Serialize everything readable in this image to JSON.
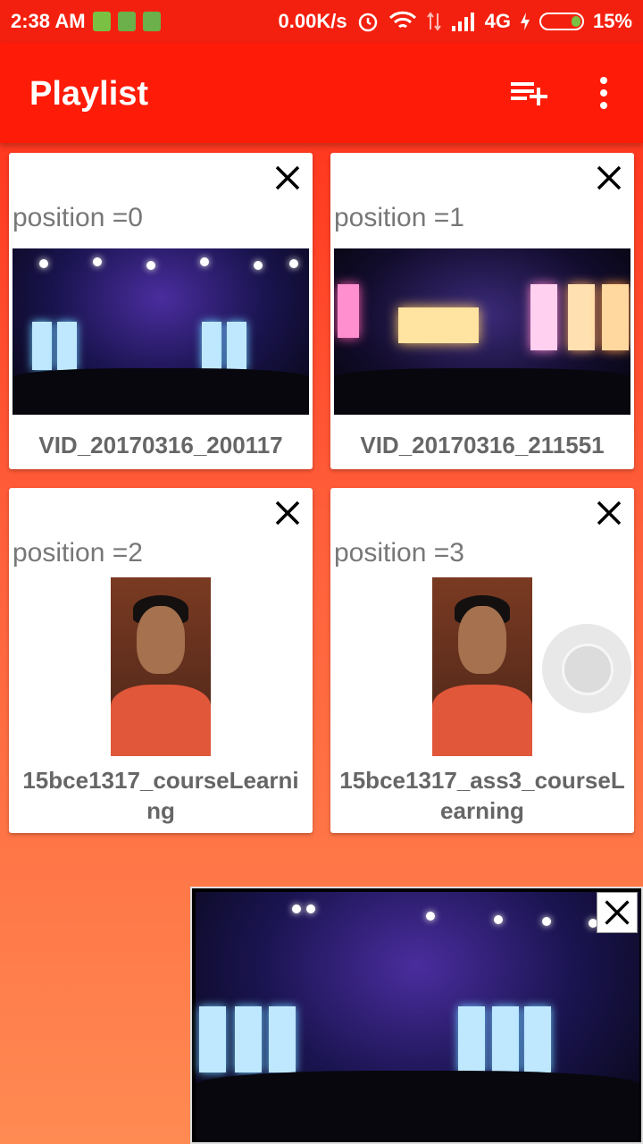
{
  "status_bar": {
    "time": "2:38 AM",
    "net_speed": "0.00K/s",
    "network": "4G",
    "battery": "15%"
  },
  "app_bar": {
    "title": "Playlist",
    "actions": [
      "playlist-add-icon",
      "more-vert-icon"
    ]
  },
  "playlist": [
    {
      "position_label": "position =0",
      "name": "VID_20170316_200117",
      "thumb": "concert-stage"
    },
    {
      "position_label": "position =1",
      "name": "VID_20170316_211551",
      "thumb": "concert-stage"
    },
    {
      "position_label": "position =2",
      "name": "15bce1317_courseLearning",
      "thumb": "selfie"
    },
    {
      "position_label": "position =3",
      "name": "15bce1317_ass3_courseLearning",
      "thumb": "selfie"
    }
  ],
  "player": {
    "close_icon": "close-icon",
    "thumb": "concert-stage"
  },
  "colors": {
    "app_bar": "#fe1b08",
    "status_bar": "#f4200f",
    "background_top": "#ff2a16",
    "background_bottom": "#ff8a52"
  }
}
